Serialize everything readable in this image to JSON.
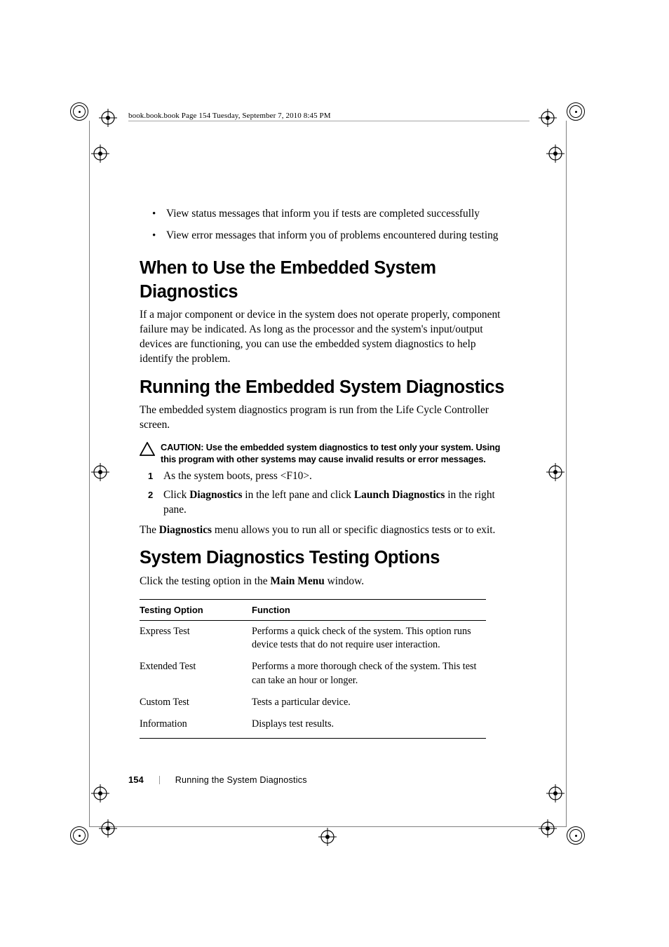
{
  "running_head": "book.book.book  Page 154  Tuesday, September 7, 2010  8:45 PM",
  "bullets": [
    "View status messages that inform you if tests are completed successfully",
    "View error messages that inform you of problems encountered during testing"
  ],
  "sections": {
    "when": {
      "title": "When to Use the Embedded System Diagnostics",
      "body": "If a major component or device in the system does not operate properly, component failure may be indicated. As long as the processor and the system's input/output devices are functioning, you can use the embedded system diagnostics to help identify the problem."
    },
    "running": {
      "title": "Running the Embedded System Diagnostics",
      "body": "The embedded system diagnostics program is run from the Life Cycle Controller screen.",
      "caution_label": "CAUTION: ",
      "caution_text": "Use the embedded system diagnostics to test only your system. Using this program with other systems may cause invalid results or error messages.",
      "steps": {
        "s1": "As the system boots, press <F10>.",
        "s2_a": "Click ",
        "s2_b": "Diagnostics",
        "s2_c": " in the left pane and click ",
        "s2_d": "Launch Diagnostics",
        "s2_e": " in the right pane."
      },
      "after_a": "The ",
      "after_b": "Diagnostics",
      "after_c": " menu allows you to run all or specific diagnostics tests or to exit."
    },
    "options": {
      "title": "System Diagnostics Testing Options",
      "intro_a": "Click the testing option in the ",
      "intro_b": "Main Menu",
      "intro_c": " window.",
      "th1": "Testing Option",
      "th2": "Function",
      "rows": [
        {
          "opt": "Express Test",
          "fn": "Performs a quick check of the system. This option runs device tests that do not require user interaction."
        },
        {
          "opt": "Extended Test",
          "fn": "Performs a more thorough check of the system. This test can take an hour or longer."
        },
        {
          "opt": "Custom Test",
          "fn": "Tests a particular device."
        },
        {
          "opt": "Information",
          "fn": "Displays test results."
        }
      ]
    }
  },
  "footer": {
    "page": "154",
    "text": "Running the System Diagnostics"
  }
}
